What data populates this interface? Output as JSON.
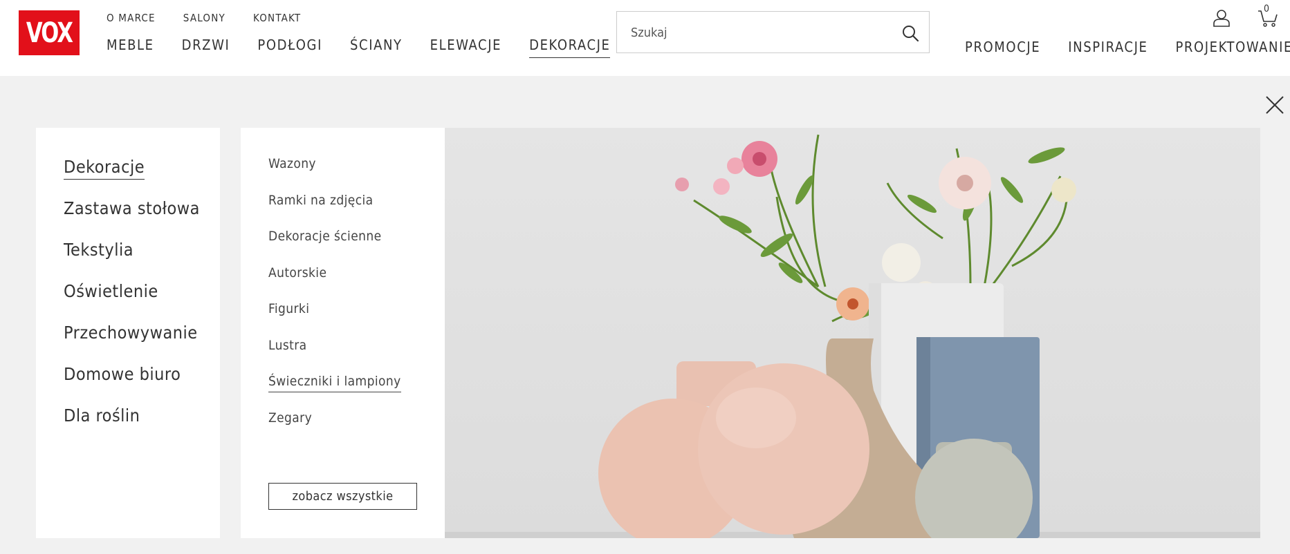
{
  "brand": {
    "logo_text": "VOX",
    "accent": "#e2101a"
  },
  "top_links": [
    "O MARCE",
    "SALONY",
    "KONTAKT"
  ],
  "main_nav": [
    {
      "label": "MEBLE",
      "active": false
    },
    {
      "label": "DRZWI",
      "active": false
    },
    {
      "label": "PODŁOGI",
      "active": false
    },
    {
      "label": "ŚCIANY",
      "active": false
    },
    {
      "label": "ELEWACJE",
      "active": false
    },
    {
      "label": "DEKORACJE",
      "active": true
    }
  ],
  "search": {
    "placeholder": "Szukaj",
    "icon": "search-icon"
  },
  "right_nav": [
    "PROMOCJE",
    "INSPIRACJE",
    "PROJEKTOWANIE"
  ],
  "header_icons": {
    "user": "user-icon",
    "cart": "cart-icon",
    "cart_count": "0"
  },
  "menu": {
    "close_icon": "close-icon",
    "categories": [
      {
        "label": "Dekoracje",
        "active": true
      },
      {
        "label": "Zastawa stołowa",
        "active": false
      },
      {
        "label": "Tekstylia",
        "active": false
      },
      {
        "label": "Oświetlenie",
        "active": false
      },
      {
        "label": "Przechowywanie",
        "active": false
      },
      {
        "label": "Domowe biuro",
        "active": false
      },
      {
        "label": "Dla roślin",
        "active": false
      }
    ],
    "subcategories": [
      {
        "label": "Wazony",
        "active": false
      },
      {
        "label": "Ramki na zdjęcia",
        "active": false
      },
      {
        "label": "Dekoracje ścienne",
        "active": false
      },
      {
        "label": "Autorskie",
        "active": false
      },
      {
        "label": "Figurki",
        "active": false
      },
      {
        "label": "Lustra",
        "active": false
      },
      {
        "label": "Świeczniki i lampiony",
        "active": true
      },
      {
        "label": "Zegary",
        "active": false
      }
    ],
    "see_all": "zobacz wszystkie"
  }
}
